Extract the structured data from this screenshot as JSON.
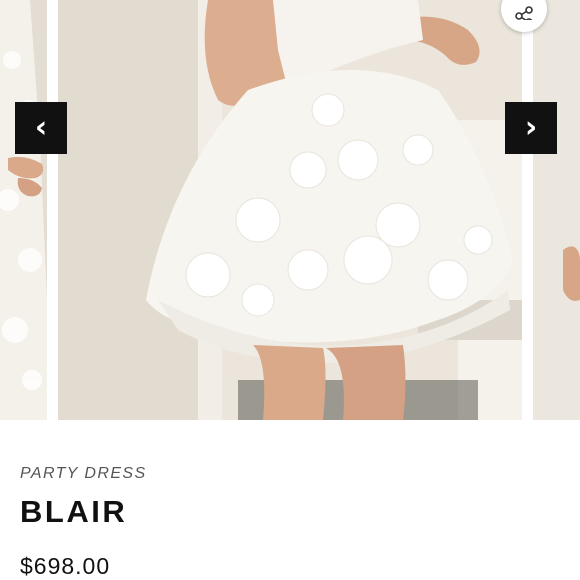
{
  "gallery": {
    "prev_label": "‹",
    "next_label": "›",
    "share_icon": "share-icon",
    "image_alt": "white floral lace party dress"
  },
  "product": {
    "category": "PARTY DRESS",
    "name": "BLAIR",
    "price": "$698.00"
  },
  "colors": {
    "arrow_bg": "#111111",
    "dress": "#f7f5f0",
    "wall": "#e8e1d6"
  }
}
